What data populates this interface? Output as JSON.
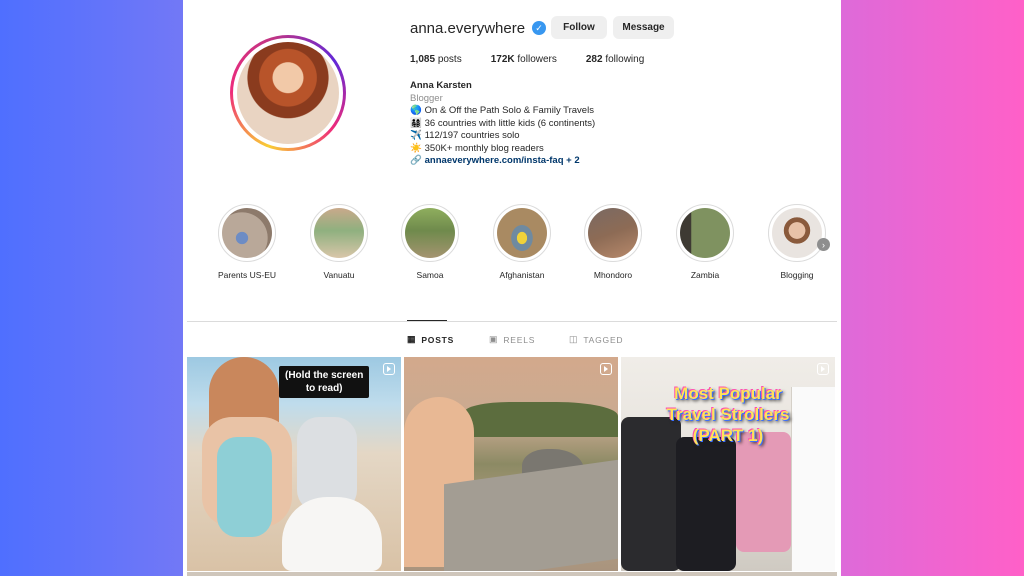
{
  "profile": {
    "username": "anna.everywhere",
    "follow_label": "Follow",
    "message_label": "Message",
    "stats": {
      "posts": "1,085",
      "posts_label": "posts",
      "followers": "172K",
      "followers_label": "followers",
      "following": "282",
      "following_label": "following"
    },
    "bio": {
      "name": "Anna Karsten",
      "category": "Blogger",
      "lines": [
        {
          "icon": "🌎",
          "text": "On & Off the Path Solo & Family Travels"
        },
        {
          "icon": "👨‍👩‍👧‍👦",
          "text": "36 countries with little kids (6 continents)"
        },
        {
          "icon": "✈️",
          "text": "112/197 countries solo"
        },
        {
          "icon": "☀️",
          "text": "350K+ monthly blog readers"
        }
      ],
      "link_icon": "🔗",
      "link": "annaeverywhere.com/insta-faq",
      "link_extra": "+ 2"
    }
  },
  "highlights": [
    {
      "label": "Parents US-EU",
      "color": "#b9a899"
    },
    {
      "label": "Vanuatu",
      "color": "#8fb07f"
    },
    {
      "label": "Samoa",
      "color": "#6f8a4c"
    },
    {
      "label": "Afghanistan",
      "color": "#a98a62"
    },
    {
      "label": "Mhondoro",
      "color": "#8d6b55"
    },
    {
      "label": "Zambia",
      "color": "#7f9260"
    },
    {
      "label": "Blogging",
      "color": "#d9c3b4"
    }
  ],
  "tabs": [
    {
      "label": "POSTS",
      "icon": "▦",
      "active": true
    },
    {
      "label": "REELS",
      "icon": "▣",
      "active": false
    },
    {
      "label": "TAGGED",
      "icon": "◫",
      "active": false
    }
  ],
  "posts": [
    {
      "caption": "(Hold the screen\nto read)"
    },
    {
      "caption": ""
    },
    {
      "caption": "Most Popular\nTravel Strollers\n(PART 1)"
    }
  ]
}
